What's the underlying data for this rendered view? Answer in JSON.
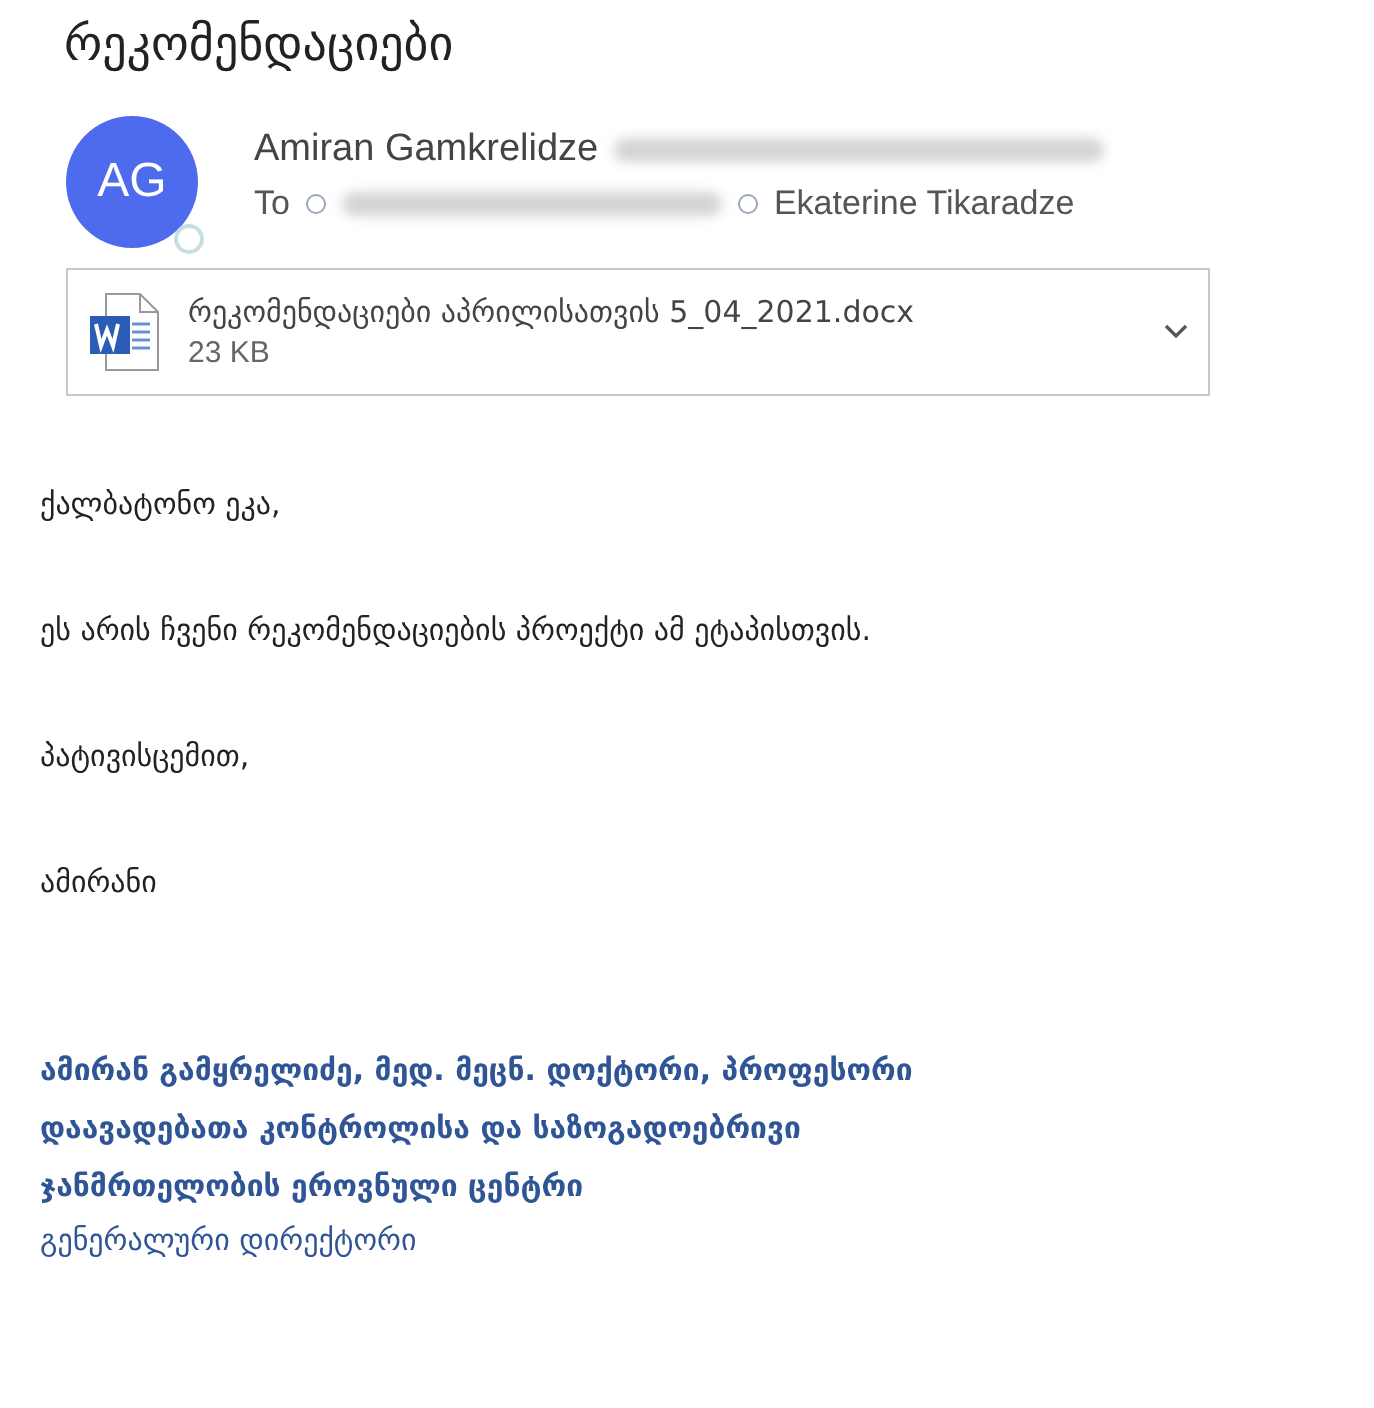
{
  "subject": "რეკომენდაციები",
  "sender": {
    "initials": "AG",
    "name": "Amiran Gamkrelidze",
    "email_redacted": true
  },
  "to": {
    "label": "To",
    "recipients": [
      {
        "kind": "redacted"
      },
      {
        "kind": "name",
        "name": "Ekaterine Tikaradze"
      }
    ]
  },
  "attachment": {
    "filename": "რეკომენდაციები აპრილისათვის 5_04_2021.docx",
    "size": "23 KB"
  },
  "body": [
    "ქალბატონო ეკა,",
    "ეს არის ჩვენი რეკომენდაციების პროექტი ამ ეტაპისთვის.",
    "პატივისცემით,",
    "ამირანი"
  ],
  "signature": [
    {
      "kind": "bold",
      "text": "ამირან გამყრელიძე, მედ. მეცნ. დოქტორი, პროფესორი"
    },
    {
      "kind": "bold",
      "text": "დაავადებათა კონტროლისა და საზოგადოებრივი"
    },
    {
      "kind": "bold",
      "text": "ჯანმრთელობის ეროვნული ცენტრი"
    },
    {
      "kind": "plain",
      "text": "გენერალური დირექტორი"
    }
  ]
}
